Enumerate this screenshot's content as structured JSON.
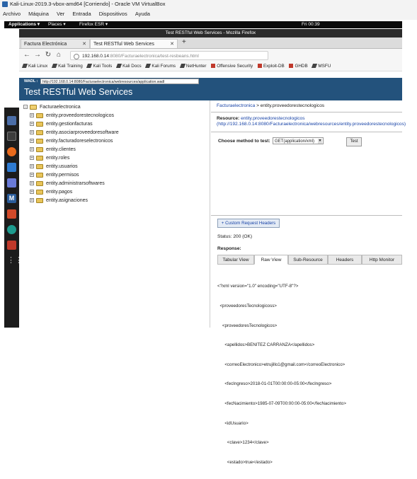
{
  "vbox": {
    "title": "Kali-Linux-2019.3-vbox-amd64 [Corriendo] - Oracle VM VirtualBox",
    "menu": [
      "Archivo",
      "Máquina",
      "Ver",
      "Entrada",
      "Dispositivos",
      "Ayuda"
    ]
  },
  "kali_panel": {
    "applications": "Applications ▾",
    "places": "Places ▾",
    "firefox": "Firefox ESR ▾",
    "clock": "Fri 00:39"
  },
  "firefox": {
    "window_title": "Test RESTful Web Services - Mozilla Firefox",
    "tabs": [
      {
        "label": "Factura Electrónica"
      },
      {
        "label": "Test RESTful Web Services"
      }
    ],
    "url_host": "192.168.0.14",
    "url_rest": ":8080/Facturaelectronica/test-resbeans.html",
    "bookmarks": [
      "Kali Linux",
      "Kali Training",
      "Kali Tools",
      "Kali Docs",
      "Kali Forums",
      "NetHunter",
      "Offensive Security",
      "Exploit-DB",
      "GHDB",
      "MSFU"
    ]
  },
  "page": {
    "wadl_label": "WADL :",
    "wadl_url": "http://192.168.0.14:8080/Facturaelectronica/webresources/application.wadl",
    "title": "Test RESTful Web Services"
  },
  "tree": {
    "root": "Facturaelectronica",
    "items": [
      "entity.proveedorestecnologicos",
      "entity.gestionfacturas",
      "entity.asociarproveedoresoftware",
      "entity.facturadoreselectronicos",
      "entity.clientes",
      "entity.roles",
      "entity.usuarios",
      "entity.permisos",
      "entity.administrarsoftwares",
      "entity.pagos",
      "entity.asignaciones"
    ]
  },
  "right": {
    "breadcrumb_link": "Facturaelectronica",
    "breadcrumb_rest": " > entity.proveedorestecnologicos",
    "resource_label": "Resource:",
    "resource_link": "entity.proveedorestecnologicos",
    "resource_url": "(http://192.168.0.14:8080/Facturaelectronica/webresources/entity.proveedorestecnologicos)",
    "method_label": "Choose method to test:",
    "method_value": "GET(application/xml)",
    "test_button": "Test",
    "custom_headers": "+ Custom Request Headers",
    "status": "Status: 200 (OK)",
    "response_label": "Response:",
    "response_tabs": [
      "Tabular View",
      "Raw View",
      "Sub-Resource",
      "Headers",
      "Http Monitor"
    ],
    "xml_lines": [
      "<?xml version=\"1.0\" encoding=\"UTF-8\"?>",
      "  <proveedoresTecnologicoss>",
      "    <proveedoresTecnologicos>",
      "      <apellidos>BENITEZ CARRANZA</apellidos>",
      "      <correoElectronico>etrujillo1@gmail.com</correoElectronico>",
      "      <fecIngreso>2018-01-01T00:00:00-05:00</fecIngreso>",
      "      <fecNacimiento>1985-07-09T00:00:00-05:00</fecNacimiento>",
      "      <idUsuario>",
      "        <clave>1234</clave>",
      "        <estado>true</estado>"
    ]
  }
}
